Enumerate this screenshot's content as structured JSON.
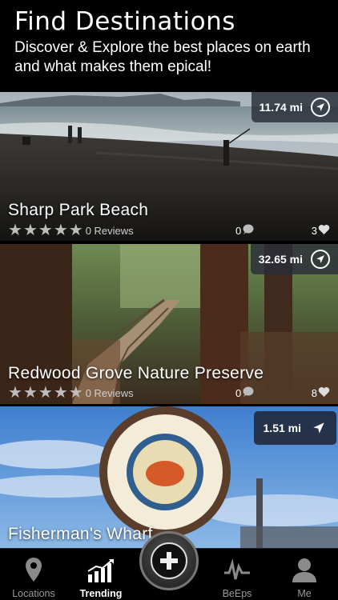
{
  "header": {
    "title": "Find Destinations",
    "subtitle": "Discover & Explore the best places on earth and what makes them epical!"
  },
  "destinations": [
    {
      "name": "Sharp Park Beach",
      "distance": "11.74 mi",
      "reviews": "0 Reviews",
      "comments": "0",
      "likes": "3",
      "rating": 0
    },
    {
      "name": "Redwood Grove Nature Preserve",
      "distance": "32.65 mi",
      "reviews": "0 Reviews",
      "comments": "0",
      "likes": "8",
      "rating": 0
    },
    {
      "name": "Fisherman's Wharf",
      "distance": "1.51 mi"
    }
  ],
  "tabs": {
    "locations": "Locations",
    "trending": "Trending",
    "beeps": "BeEps",
    "me": "Me"
  }
}
